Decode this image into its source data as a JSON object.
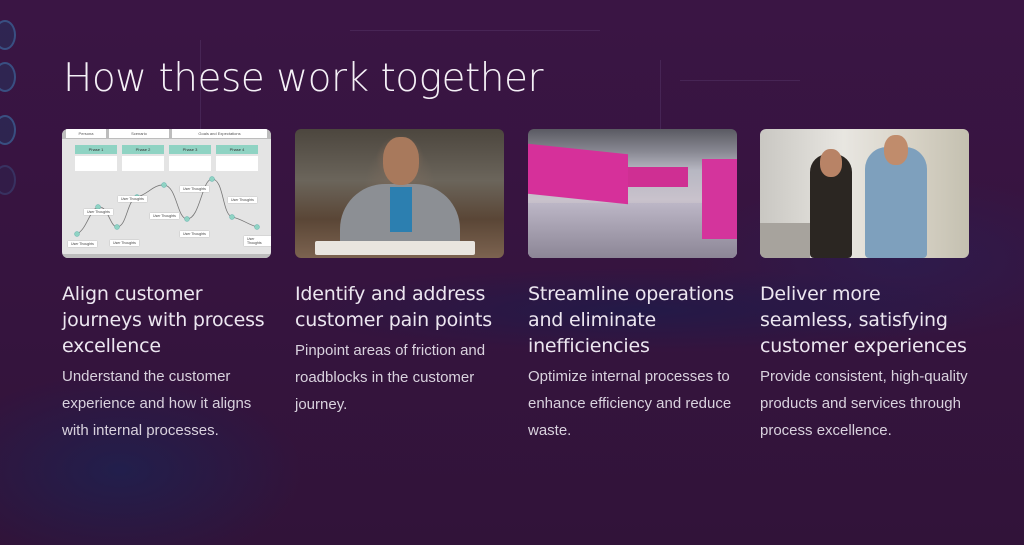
{
  "page": {
    "title": "How these work together"
  },
  "cards": [
    {
      "image": "customer-journey-map",
      "heading": "Align customer journeys with process excellence",
      "body": "Understand the customer experience and how it aligns with internal processes.",
      "journey_map": {
        "header": [
          "Persona",
          "Scenario",
          "Goals and Expectations"
        ],
        "phases": [
          "Phase 1",
          "Phase 2",
          "Phase 3",
          "Phase 4"
        ],
        "note_label": "User Thoughts"
      }
    },
    {
      "image": "frustrated-man-at-desk",
      "heading": "Identify and address customer pain points",
      "body": "Pinpoint areas of friction and roadblocks in the customer journey."
    },
    {
      "image": "pink-factory-floor",
      "heading": "Streamline operations and eliminate inefficiencies",
      "body": "Optimize internal processes to enhance efficiency and reduce waste."
    },
    {
      "image": "happy-customers-thumbs-up",
      "heading": "Deliver more seamless, satisfying customer experiences",
      "body": "Provide consistent, high-quality products and services through process excellence."
    }
  ],
  "colors": {
    "background": "#361540",
    "title": "#f4f0f6",
    "heading": "#ece6f0",
    "body": "#d9d2de",
    "phase_header": "#8fd3c3"
  }
}
